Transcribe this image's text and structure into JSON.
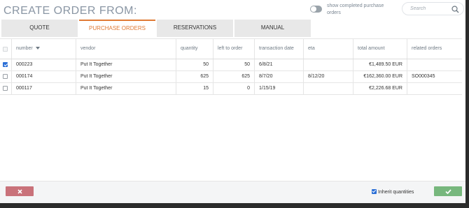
{
  "dialog": {
    "title": "CREATE ORDER FROM:",
    "show_completed_label": "show completed purchase orders",
    "show_completed_on": false
  },
  "search": {
    "placeholder": "Search",
    "value": ""
  },
  "tabs": [
    {
      "label": "QUOTE",
      "active": false
    },
    {
      "label": "PURCHASE ORDERS",
      "active": true
    },
    {
      "label": "RESERVATIONS",
      "active": false
    },
    {
      "label": "MANUAL",
      "active": false
    }
  ],
  "table": {
    "columns": [
      "number",
      "vendor",
      "quantity",
      "left to order",
      "transaction date",
      "eta",
      "total amount",
      "related orders"
    ],
    "sort_column": "number",
    "rows": [
      {
        "checked": true,
        "number": "000223",
        "vendor": "Put It Together",
        "quantity": "50",
        "left_to_order": "50",
        "transaction_date": "6/8/21",
        "eta": "",
        "total_amount": "€1,489.50 EUR",
        "related_orders": ""
      },
      {
        "checked": false,
        "number": "000174",
        "vendor": "Put It Together",
        "quantity": "625",
        "left_to_order": "625",
        "transaction_date": "8/7/20",
        "eta": "8/12/20",
        "total_amount": "€162,360.00 EUR",
        "related_orders": "SO000345"
      },
      {
        "checked": false,
        "number": "000117",
        "vendor": "Put It Together",
        "quantity": "15",
        "left_to_order": "0",
        "transaction_date": "1/15/19",
        "eta": "",
        "total_amount": "€2,226.68 EUR",
        "related_orders": ""
      }
    ]
  },
  "footer": {
    "cancel_icon": "close-icon",
    "confirm_icon": "checkmark-icon",
    "inherit_label": "Inherit quantities",
    "inherit_checked": true
  },
  "colors": {
    "accent": "#e07a35",
    "cancel": "#c9727a",
    "confirm": "#77b77d",
    "checkbox": "#2b6fd6",
    "title": "#8a96a4"
  }
}
